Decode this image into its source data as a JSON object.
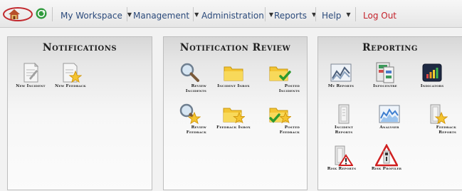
{
  "nav": {
    "items": [
      {
        "label": "My Workspace"
      },
      {
        "label": "Management"
      },
      {
        "label": "Administration"
      },
      {
        "label": "Reports"
      },
      {
        "label": "Help"
      }
    ],
    "logout": "Log Out",
    "icons": {
      "home": "home-icon",
      "refresh": "refresh-icon"
    },
    "colors": {
      "link": "#2b4a7b",
      "logout": "#c4222b",
      "highlight_ring": "#c2282d"
    }
  },
  "panels": {
    "notifications": {
      "title": "Notifications",
      "tiles": [
        {
          "label1": "New Incident",
          "label2": "",
          "icon": "new-incident-icon"
        },
        {
          "label1": "New Feedback",
          "label2": "",
          "icon": "new-feedback-icon"
        }
      ]
    },
    "review": {
      "title": "Notification Review",
      "tiles": [
        {
          "label1": "Review",
          "label2": "Incidents",
          "icon": "review-incidents-icon"
        },
        {
          "label1": "Incident Inbox",
          "label2": "",
          "icon": "incident-inbox-icon"
        },
        {
          "label1": "Posted",
          "label2": "Incidents",
          "icon": "posted-incidents-icon"
        },
        {
          "label1": "Review",
          "label2": "Feedback",
          "icon": "review-feedback-icon"
        },
        {
          "label1": "Feedback Inbox",
          "label2": "",
          "icon": "feedback-inbox-icon"
        },
        {
          "label1": "Posted",
          "label2": "Feedback",
          "icon": "posted-feedback-icon"
        }
      ]
    },
    "reporting": {
      "title": "Reporting",
      "tiles": [
        {
          "label1": "My Reports",
          "label2": "",
          "icon": "my-reports-icon"
        },
        {
          "label1": "Infocentre",
          "label2": "",
          "icon": "infocentre-icon"
        },
        {
          "label1": "Indicators",
          "label2": "",
          "icon": "indicators-icon"
        },
        {
          "label1": "Incident",
          "label2": "Reports",
          "icon": "incident-reports-icon"
        },
        {
          "label1": "Analyser",
          "label2": "",
          "icon": "analyser-icon"
        },
        {
          "label1": "Feedback",
          "label2": "Reports",
          "icon": "feedback-reports-icon"
        },
        {
          "label1": "Risk Reports",
          "label2": "",
          "icon": "risk-reports-icon"
        },
        {
          "label1": "Risk Profiler",
          "label2": "",
          "icon": "risk-profiler-icon"
        }
      ]
    }
  }
}
